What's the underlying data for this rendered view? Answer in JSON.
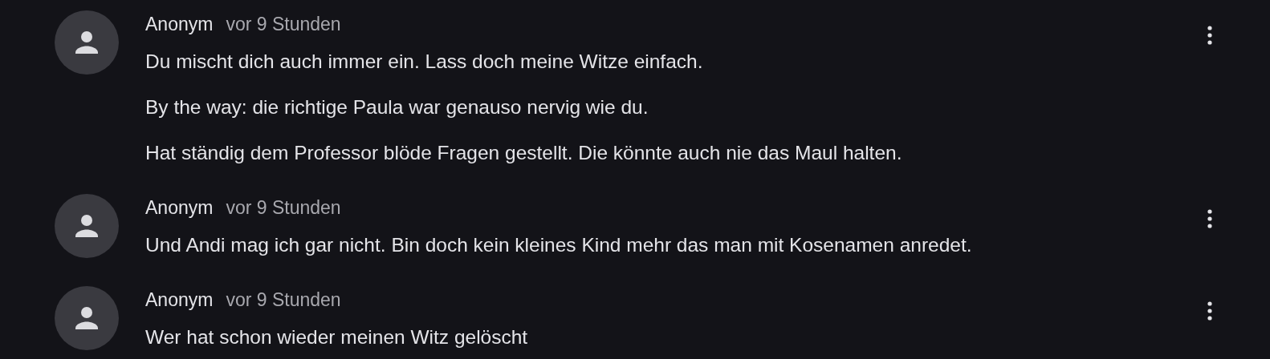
{
  "comments": [
    {
      "author": "Anonym",
      "time": "vor 9 Stunden",
      "paragraphs": [
        "Du mischt dich auch immer ein. Lass doch meine Witze einfach.",
        "By the way: die richtige Paula war genauso nervig wie du.",
        "Hat ständig dem Professor blöde Fragen gestellt. Die könnte auch nie das Maul halten."
      ]
    },
    {
      "author": "Anonym",
      "time": "vor 9 Stunden",
      "paragraphs": [
        "Und Andi mag ich gar nicht. Bin doch kein kleines Kind mehr das man mit Kosenamen anredet."
      ]
    },
    {
      "author": "Anonym",
      "time": "vor 9 Stunden",
      "paragraphs": [
        "Wer hat schon wieder meinen Witz gelöscht"
      ]
    }
  ]
}
